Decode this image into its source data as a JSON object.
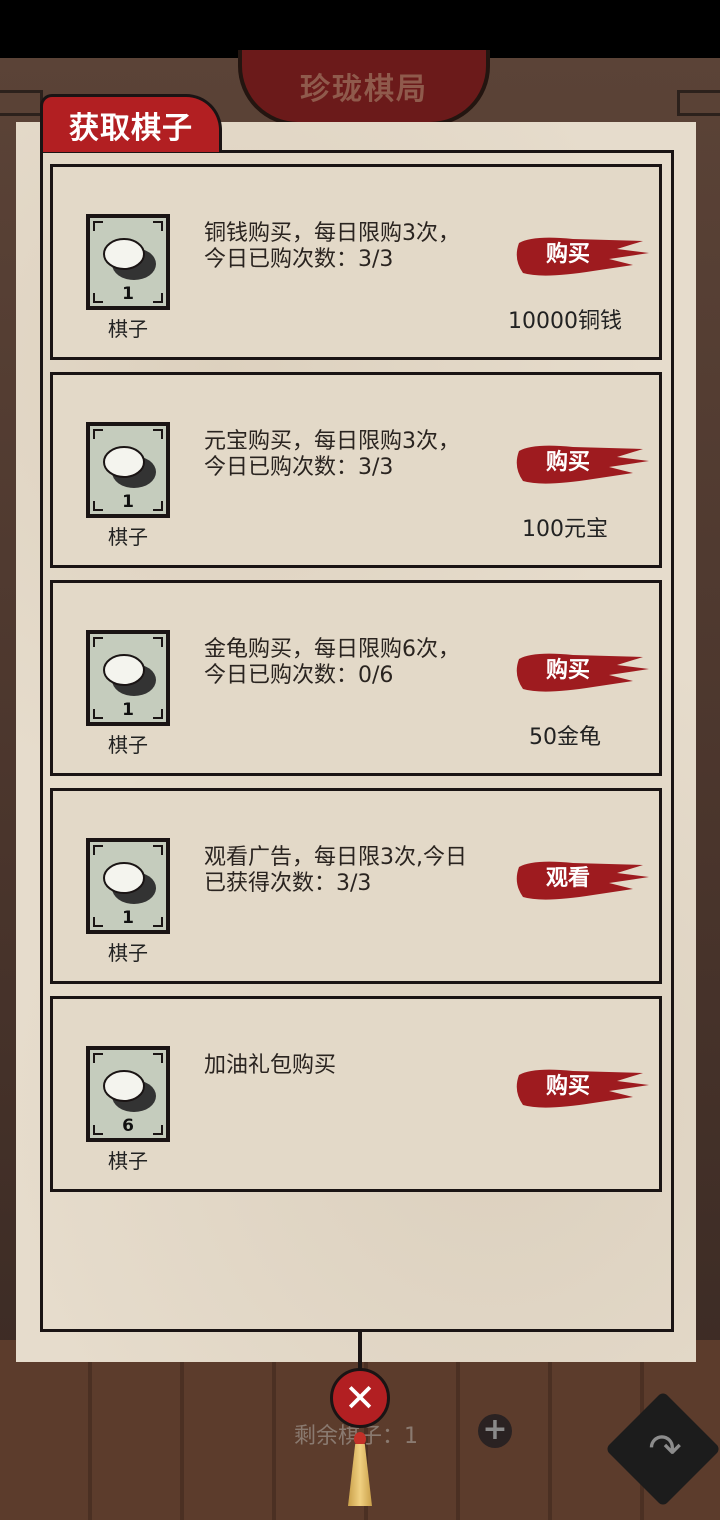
{
  "header": {
    "title": "珍珑棋局"
  },
  "panel": {
    "title": "获取棋子"
  },
  "items": [
    {
      "desc": "铜钱购买，每日限购3次，今日已购次数：3/3",
      "count": "1",
      "name": "棋子",
      "button": "购买",
      "price": "10000铜钱"
    },
    {
      "desc": "元宝购买，每日限购3次，今日已购次数：3/3",
      "count": "1",
      "name": "棋子",
      "button": "购买",
      "price": "100元宝"
    },
    {
      "desc": "金龟购买，每日限购6次，今日已购次数：0/6",
      "count": "1",
      "name": "棋子",
      "button": "购买",
      "price": "50金龟"
    },
    {
      "desc": "观看广告，每日限3次,今日已获得次数：3/3",
      "count": "1",
      "name": "棋子",
      "button": "观看",
      "price": ""
    },
    {
      "desc": "加油礼包购买",
      "count": "6",
      "name": "棋子",
      "button": "购买",
      "price": ""
    }
  ],
  "footer": {
    "remaining": "剩余棋子：1",
    "plus": "+",
    "close": "✕",
    "share": "↷"
  },
  "colors": {
    "accent_red": "#b21f22",
    "paper": "#e6dccc",
    "ink": "#1a1414"
  }
}
